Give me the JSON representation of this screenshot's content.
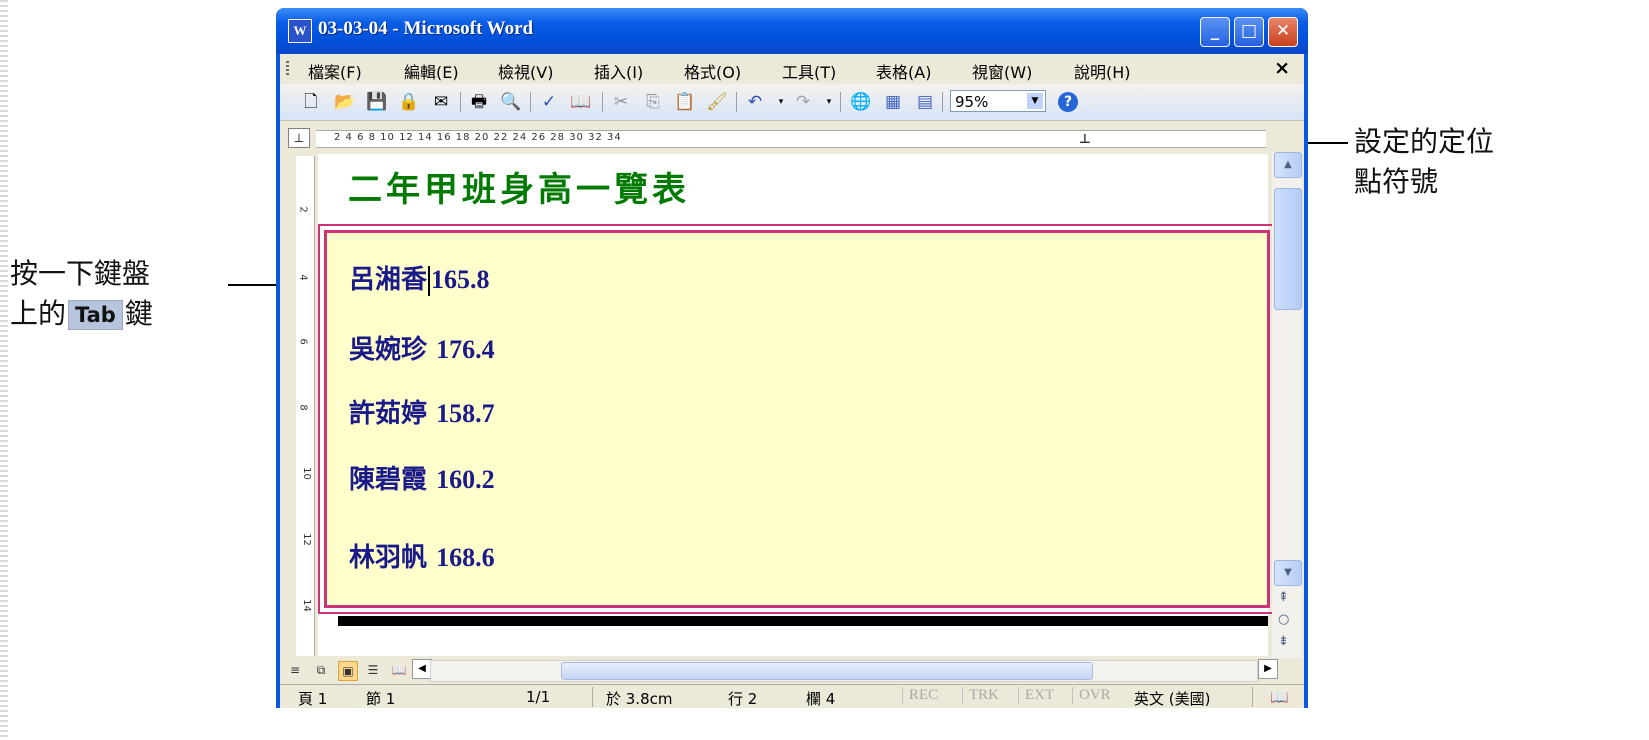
{
  "window": {
    "title": "03-03-04 - Microsoft Word",
    "icon_label": "W",
    "minimize_glyph": "_",
    "maximize_glyph": "□",
    "close_glyph": "✕"
  },
  "menubar": {
    "items": [
      "檔案(F)",
      "編輯(E)",
      "檢視(V)",
      "插入(I)",
      "格式(O)",
      "工具(T)",
      "表格(A)",
      "視窗(W)",
      "說明(H)"
    ],
    "close_glyph": "×"
  },
  "toolbar": {
    "zoom": "95%",
    "help_glyph": "?"
  },
  "ruler": {
    "numbers": "2  4  6  8  10  12  14  16  18  20  22  24  26  28  30  32  34",
    "tab_stop_glyph": "⊥"
  },
  "vertical_ruler": {
    "numbers": [
      "2",
      "4",
      "6",
      "8",
      "10",
      "12",
      "14"
    ]
  },
  "document": {
    "heading": "二年甲班身高一覽表",
    "rows": [
      {
        "name": "呂湘香",
        "value": "165.8"
      },
      {
        "name": "吳婉珍",
        "value": "176.4"
      },
      {
        "name": "許茹婷",
        "value": "158.7"
      },
      {
        "name": "陳碧霞",
        "value": "160.2"
      },
      {
        "name": "林羽帆",
        "value": "168.6"
      }
    ]
  },
  "statusbar": {
    "page": "頁 1",
    "section": "節 1",
    "page_count": "1/1",
    "position": "於 3.8cm",
    "line": "行 2",
    "column": "欄 4",
    "rec": "REC",
    "trk": "TRK",
    "ext": "EXT",
    "ovr": "OVR",
    "language": "英文 (美國)"
  },
  "annotations": {
    "right_line1": "設定的定位",
    "right_line2": "點符號",
    "left_line1": "按一下鍵盤",
    "left_line2_prefix": "上的",
    "left_key": "Tab",
    "left_line2_suffix": "鍵"
  },
  "colors": {
    "titlebar": "#0050da",
    "heading": "#007a00",
    "content_bg": "#ffffcc",
    "content_border": "#cc3377",
    "row_text": "#1a1a8a"
  }
}
